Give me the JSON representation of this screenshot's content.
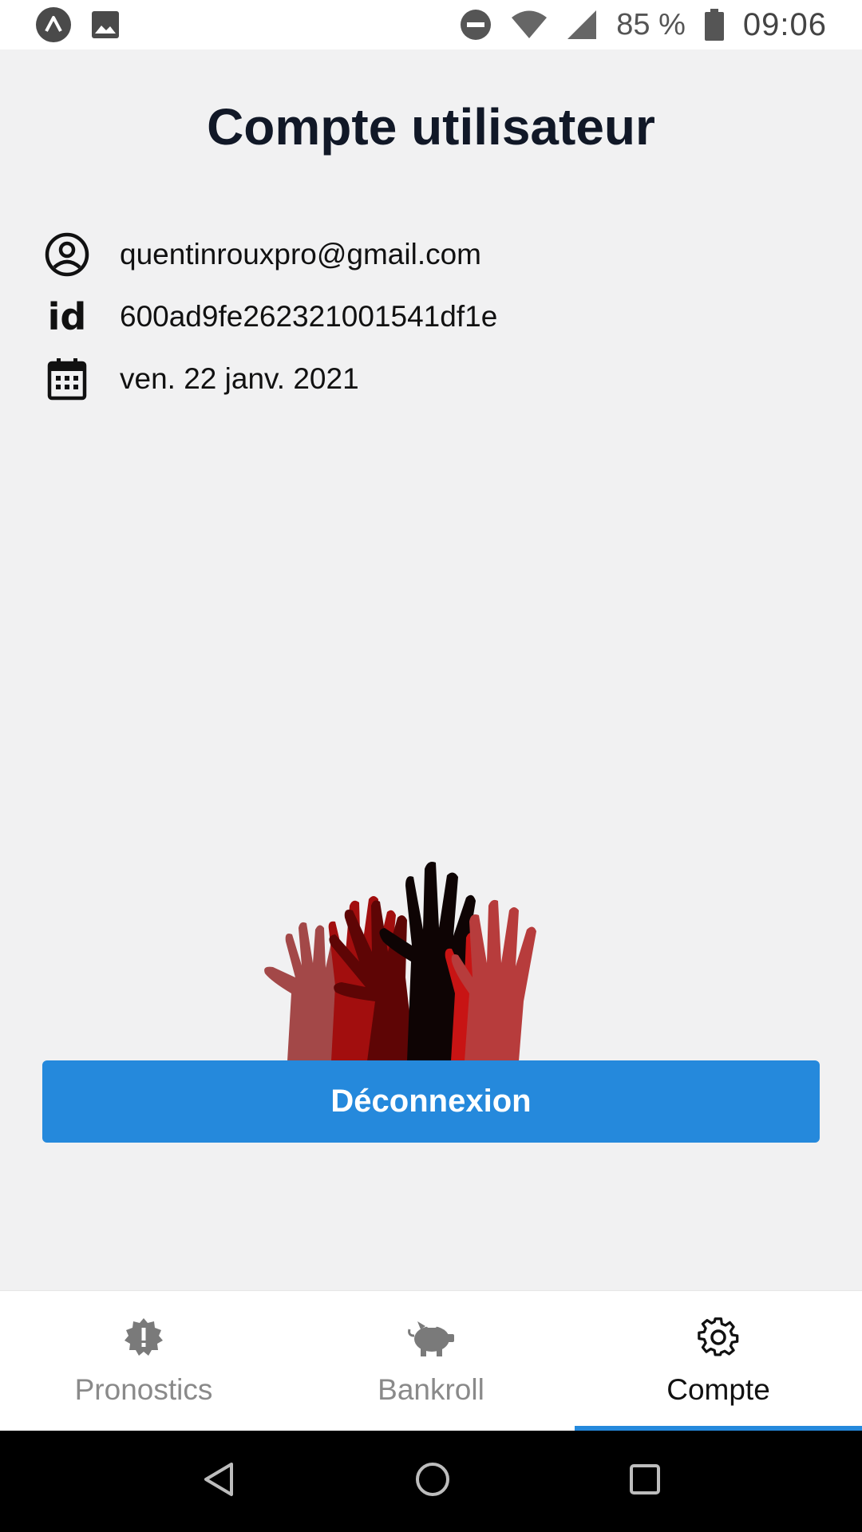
{
  "status_bar": {
    "battery_percent": "85 %",
    "time": "09:06"
  },
  "page": {
    "title": "Compte utilisateur"
  },
  "account": {
    "email": "quentinrouxpro@gmail.com",
    "id_label": "id",
    "id_value": "600ad9fe262321001541df1e",
    "date": "ven. 22 janv. 2021"
  },
  "actions": {
    "logout_label": "Déconnexion"
  },
  "tabs": [
    {
      "label": "Pronostics",
      "icon": "alert-badge-icon",
      "active": false
    },
    {
      "label": "Bankroll",
      "icon": "piggy-bank-icon",
      "active": false
    },
    {
      "label": "Compte",
      "icon": "gear-icon",
      "active": true
    }
  ],
  "colors": {
    "accent": "#2589dc",
    "background": "#f1f1f2",
    "hand_colors": [
      "#a34848",
      "#a20e0e",
      "#5e0505",
      "#0e0404",
      "#c81414",
      "#b73c3c"
    ]
  }
}
